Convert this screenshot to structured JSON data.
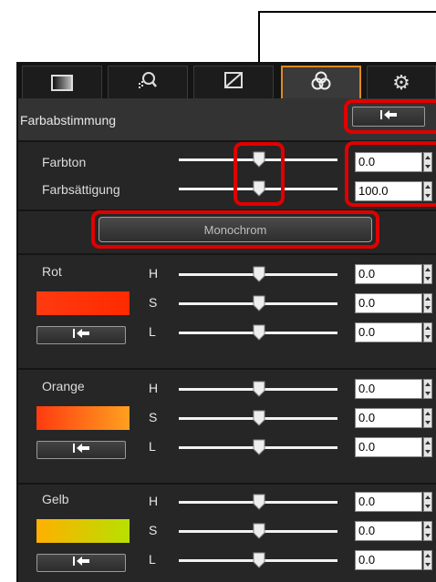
{
  "tabs": [
    {
      "icon": "basic-adjust-icon"
    },
    {
      "icon": "dust-noise-icon"
    },
    {
      "icon": "tone-curve-icon"
    },
    {
      "icon": "color-adjust-icon",
      "active": true
    },
    {
      "icon": "gear-icon"
    }
  ],
  "section": {
    "title": "Farbabstimmung"
  },
  "global": {
    "hue_label": "Farbton",
    "hue_value": "0.0",
    "sat_label": "Farbsättigung",
    "sat_value": "100.0",
    "mono_label": "Monochrom"
  },
  "channels": [
    {
      "name": "Rot",
      "h": "0.0",
      "s": "0.0",
      "l": "0.0",
      "swatch": [
        "#ff3a10",
        "#ff2a00"
      ]
    },
    {
      "name": "Orange",
      "h": "0.0",
      "s": "0.0",
      "l": "0.0",
      "swatch": [
        "#ff3b10",
        "#ffa020"
      ]
    },
    {
      "name": "Gelb",
      "h": "0.0",
      "s": "0.0",
      "l": "0.0",
      "swatch": [
        "#ffb000",
        "#b8e000"
      ]
    }
  ],
  "hsl_labels": {
    "h": "H",
    "s": "S",
    "l": "L"
  },
  "colors": {
    "highlight": "#e00000",
    "active_tab": "#e08a1e",
    "panel": "#262626"
  }
}
